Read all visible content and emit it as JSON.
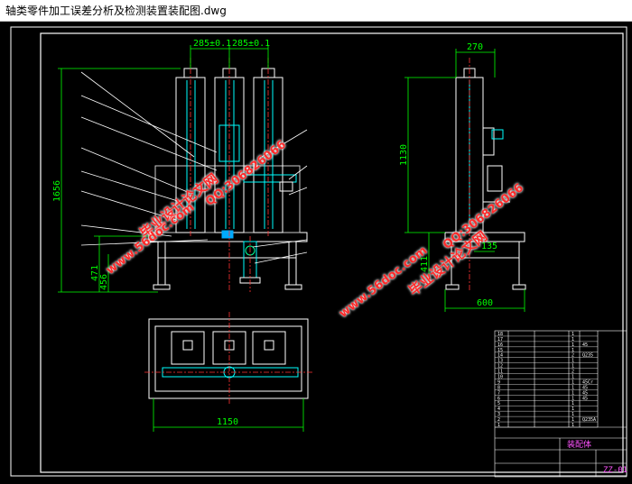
{
  "window": {
    "title": "轴类零件加工误差分析及检测装置装配图.dwg"
  },
  "dimensions": {
    "front_top_left": "285±0.1",
    "front_top_right": "285±0.1",
    "front_height": "1656",
    "front_height_mid": "471",
    "front_height_low": "456",
    "top_view_width": "1150",
    "side_top": "270",
    "side_height": "1130",
    "side_small_h": "411",
    "side_small_w": "135",
    "side_width": "600"
  },
  "watermarks": {
    "brand": "毕业设计论文网",
    "site": "www.56doc.com",
    "qq": "QQ:306826066"
  },
  "title_block": {
    "drawing_name": "装配体",
    "drawing_code": "ZZ-01"
  },
  "bom_rows": [
    {
      "no": "18",
      "material": "",
      "qty": "1"
    },
    {
      "no": "17",
      "material": "",
      "qty": "1"
    },
    {
      "no": "16",
      "material": "45",
      "qty": "1"
    },
    {
      "no": "15",
      "material": "",
      "qty": "1"
    },
    {
      "no": "14",
      "material": "Q235",
      "qty": "2"
    },
    {
      "no": "13",
      "material": "",
      "qty": "1"
    },
    {
      "no": "12",
      "material": "",
      "qty": "1"
    },
    {
      "no": "11",
      "material": "",
      "qty": "2"
    },
    {
      "no": "10",
      "material": "",
      "qty": "1"
    },
    {
      "no": "9",
      "material": "45Cr",
      "qty": "1"
    },
    {
      "no": "8",
      "material": "45",
      "qty": "1"
    },
    {
      "no": "7",
      "material": "45",
      "qty": "1"
    },
    {
      "no": "6",
      "material": "45",
      "qty": "1"
    },
    {
      "no": "5",
      "material": "",
      "qty": "1"
    },
    {
      "no": "4",
      "material": "",
      "qty": "1"
    },
    {
      "no": "3",
      "material": "",
      "qty": "1"
    },
    {
      "no": "2",
      "material": "Q235A",
      "qty": "1"
    },
    {
      "no": "1",
      "material": "",
      "qty": "1"
    }
  ],
  "colors": {
    "background": "#000000",
    "frame": "#ffffff",
    "dimension": "#00ff00",
    "callout": "#ffffff",
    "center": "#ff3333",
    "accent": "#00ffff",
    "watermark": "#ff2a2a"
  }
}
